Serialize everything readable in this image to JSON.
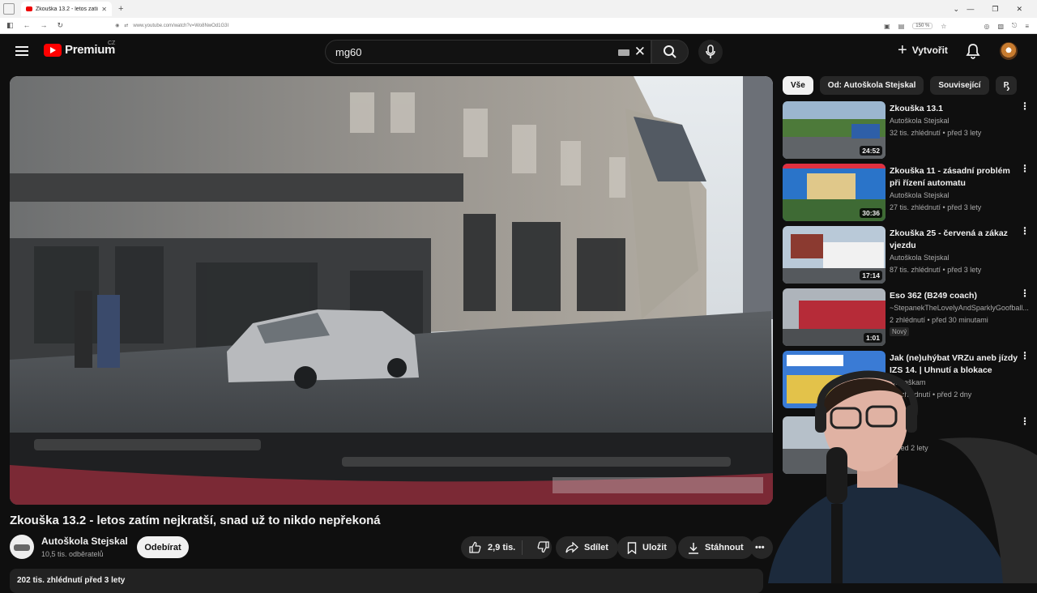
{
  "browser": {
    "tab_title": "Zkouška 13.2 - letos zatím nejk",
    "url": "www.youtube.com/watch?v=Wo8NwOd1G3I",
    "zoom": "150 %"
  },
  "header": {
    "logo": "Premium",
    "country": "CZ",
    "search_value": "mg60",
    "create_label": "Vytvořit"
  },
  "video": {
    "title": "Zkouška 13.2 - letos zatím nejkratší, snad už to nikdo nepřekoná",
    "channel": "Autoškola Stejskal",
    "subscribers": "10,5 tis. odběratelů",
    "subscribe_label": "Odebírat",
    "likes": "2,9 tis.",
    "share_label": "Sdílet",
    "save_label": "Uložit",
    "download_label": "Stáhnout",
    "views_line": "202 tis. zhlédnutí  před 3 lety"
  },
  "chips": [
    "Vše",
    "Od: Autoškola Stejskal",
    "Související",
    "P"
  ],
  "recommendations": [
    {
      "title": "Zkouška 13.1",
      "channel": "Autoškola Stejskal",
      "meta": "32 tis. zhlédnutí • před 3 lety",
      "duration": "24:52"
    },
    {
      "title": "Zkouška 11 - zásadní problém při řízení automatu",
      "channel": "Autoškola Stejskal",
      "meta": "27 tis. zhlédnutí • před 3 lety",
      "duration": "30:36"
    },
    {
      "title": "Zkouška 25 - červená a zákaz vjezdu",
      "channel": "Autoškola Stejskal",
      "meta": "87 tis. zhlédnutí • před 3 lety",
      "duration": "17:14"
    },
    {
      "title": "Eso 362 (B249 coach)",
      "channel": "~StepanekTheLovelyAndSparklyGoofball...",
      "meta": "2 zhlédnutí • před 30 minutami",
      "duration": "1:01",
      "badge": "Nový"
    },
    {
      "title": "Jak (ne)uhýbat VRZu aneb jízdy IZS 14. | Uhnutí a blokace",
      "channel": "ck Daškam",
      "meta": "tis. zhlédnutí • před 2 dny",
      "duration": ""
    },
    {
      "title": "ška 38",
      "channel": "al",
      "meta": "• před 2 lety",
      "duration": ""
    }
  ],
  "colors": {
    "background": "#0f0f0f",
    "accent_red": "#ff0000",
    "pill": "#272727"
  }
}
